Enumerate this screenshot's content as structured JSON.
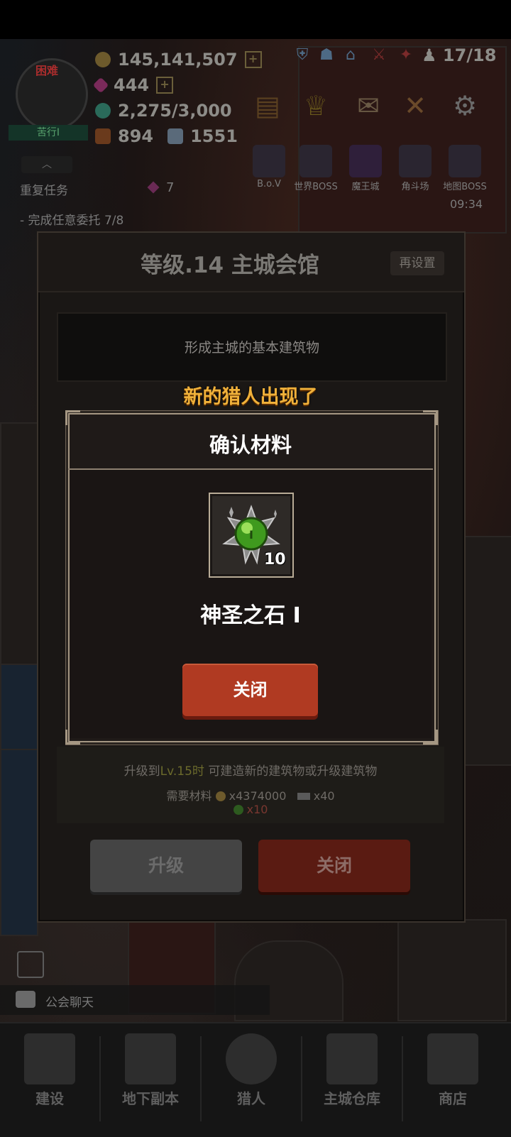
{
  "hud": {
    "avatar_badge": "困难",
    "rank": "苦行I",
    "gold": "145,141,507",
    "gems": "444",
    "stamina": "2,275/3,000",
    "chest": "894",
    "crystal": "1551",
    "hunter_capacity": "17/18",
    "time": "09:34",
    "boss_labels": [
      "B.o.V",
      "世界BOSS",
      "魔王城",
      "角斗场",
      "地图BOSS"
    ]
  },
  "quests": {
    "title": "重复任务",
    "reward": "7",
    "line": "- 完成任意委托 7/8"
  },
  "building": {
    "title": "等级.14 主城会馆",
    "reset": "再设置",
    "description": "形成主城的基本建筑物",
    "req_prefix": "升级到",
    "req_level": "Lv.15时",
    "req_suffix": " 可建造新的建筑物或升级建筑物",
    "mats_label": "需要材料",
    "mat_gold": "x4374000",
    "mat_ingot": "x40",
    "mat_stone": "x10",
    "upgrade_label": "升级",
    "close_label": "关闭"
  },
  "toast": "新的猎人出现了",
  "modal": {
    "title": "确认材料",
    "item_name": "神圣之石 I",
    "item_count": "10",
    "close_label": "关闭"
  },
  "chat": {
    "label": "公会聊天"
  },
  "nav": [
    {
      "label": "建设"
    },
    {
      "label": "地下副本"
    },
    {
      "label": "猎人"
    },
    {
      "label": "主城仓库"
    },
    {
      "label": "商店"
    }
  ],
  "colors": {
    "accent_gold": "#f0b13a",
    "close_red": "#b03a22",
    "modal_border": "#a59783"
  }
}
